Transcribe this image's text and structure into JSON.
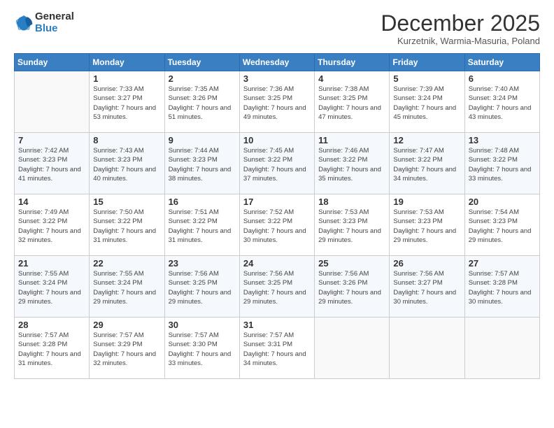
{
  "logo": {
    "general": "General",
    "blue": "Blue"
  },
  "header": {
    "month": "December 2025",
    "location": "Kurzetnik, Warmia-Masuria, Poland"
  },
  "weekdays": [
    "Sunday",
    "Monday",
    "Tuesday",
    "Wednesday",
    "Thursday",
    "Friday",
    "Saturday"
  ],
  "weeks": [
    [
      {
        "day": "",
        "sunrise": "",
        "sunset": "",
        "daylight": ""
      },
      {
        "day": "1",
        "sunrise": "Sunrise: 7:33 AM",
        "sunset": "Sunset: 3:27 PM",
        "daylight": "Daylight: 7 hours and 53 minutes."
      },
      {
        "day": "2",
        "sunrise": "Sunrise: 7:35 AM",
        "sunset": "Sunset: 3:26 PM",
        "daylight": "Daylight: 7 hours and 51 minutes."
      },
      {
        "day": "3",
        "sunrise": "Sunrise: 7:36 AM",
        "sunset": "Sunset: 3:25 PM",
        "daylight": "Daylight: 7 hours and 49 minutes."
      },
      {
        "day": "4",
        "sunrise": "Sunrise: 7:38 AM",
        "sunset": "Sunset: 3:25 PM",
        "daylight": "Daylight: 7 hours and 47 minutes."
      },
      {
        "day": "5",
        "sunrise": "Sunrise: 7:39 AM",
        "sunset": "Sunset: 3:24 PM",
        "daylight": "Daylight: 7 hours and 45 minutes."
      },
      {
        "day": "6",
        "sunrise": "Sunrise: 7:40 AM",
        "sunset": "Sunset: 3:24 PM",
        "daylight": "Daylight: 7 hours and 43 minutes."
      }
    ],
    [
      {
        "day": "7",
        "sunrise": "Sunrise: 7:42 AM",
        "sunset": "Sunset: 3:23 PM",
        "daylight": "Daylight: 7 hours and 41 minutes."
      },
      {
        "day": "8",
        "sunrise": "Sunrise: 7:43 AM",
        "sunset": "Sunset: 3:23 PM",
        "daylight": "Daylight: 7 hours and 40 minutes."
      },
      {
        "day": "9",
        "sunrise": "Sunrise: 7:44 AM",
        "sunset": "Sunset: 3:23 PM",
        "daylight": "Daylight: 7 hours and 38 minutes."
      },
      {
        "day": "10",
        "sunrise": "Sunrise: 7:45 AM",
        "sunset": "Sunset: 3:22 PM",
        "daylight": "Daylight: 7 hours and 37 minutes."
      },
      {
        "day": "11",
        "sunrise": "Sunrise: 7:46 AM",
        "sunset": "Sunset: 3:22 PM",
        "daylight": "Daylight: 7 hours and 35 minutes."
      },
      {
        "day": "12",
        "sunrise": "Sunrise: 7:47 AM",
        "sunset": "Sunset: 3:22 PM",
        "daylight": "Daylight: 7 hours and 34 minutes."
      },
      {
        "day": "13",
        "sunrise": "Sunrise: 7:48 AM",
        "sunset": "Sunset: 3:22 PM",
        "daylight": "Daylight: 7 hours and 33 minutes."
      }
    ],
    [
      {
        "day": "14",
        "sunrise": "Sunrise: 7:49 AM",
        "sunset": "Sunset: 3:22 PM",
        "daylight": "Daylight: 7 hours and 32 minutes."
      },
      {
        "day": "15",
        "sunrise": "Sunrise: 7:50 AM",
        "sunset": "Sunset: 3:22 PM",
        "daylight": "Daylight: 7 hours and 31 minutes."
      },
      {
        "day": "16",
        "sunrise": "Sunrise: 7:51 AM",
        "sunset": "Sunset: 3:22 PM",
        "daylight": "Daylight: 7 hours and 31 minutes."
      },
      {
        "day": "17",
        "sunrise": "Sunrise: 7:52 AM",
        "sunset": "Sunset: 3:22 PM",
        "daylight": "Daylight: 7 hours and 30 minutes."
      },
      {
        "day": "18",
        "sunrise": "Sunrise: 7:53 AM",
        "sunset": "Sunset: 3:23 PM",
        "daylight": "Daylight: 7 hours and 29 minutes."
      },
      {
        "day": "19",
        "sunrise": "Sunrise: 7:53 AM",
        "sunset": "Sunset: 3:23 PM",
        "daylight": "Daylight: 7 hours and 29 minutes."
      },
      {
        "day": "20",
        "sunrise": "Sunrise: 7:54 AM",
        "sunset": "Sunset: 3:23 PM",
        "daylight": "Daylight: 7 hours and 29 minutes."
      }
    ],
    [
      {
        "day": "21",
        "sunrise": "Sunrise: 7:55 AM",
        "sunset": "Sunset: 3:24 PM",
        "daylight": "Daylight: 7 hours and 29 minutes."
      },
      {
        "day": "22",
        "sunrise": "Sunrise: 7:55 AM",
        "sunset": "Sunset: 3:24 PM",
        "daylight": "Daylight: 7 hours and 29 minutes."
      },
      {
        "day": "23",
        "sunrise": "Sunrise: 7:56 AM",
        "sunset": "Sunset: 3:25 PM",
        "daylight": "Daylight: 7 hours and 29 minutes."
      },
      {
        "day": "24",
        "sunrise": "Sunrise: 7:56 AM",
        "sunset": "Sunset: 3:25 PM",
        "daylight": "Daylight: 7 hours and 29 minutes."
      },
      {
        "day": "25",
        "sunrise": "Sunrise: 7:56 AM",
        "sunset": "Sunset: 3:26 PM",
        "daylight": "Daylight: 7 hours and 29 minutes."
      },
      {
        "day": "26",
        "sunrise": "Sunrise: 7:56 AM",
        "sunset": "Sunset: 3:27 PM",
        "daylight": "Daylight: 7 hours and 30 minutes."
      },
      {
        "day": "27",
        "sunrise": "Sunrise: 7:57 AM",
        "sunset": "Sunset: 3:28 PM",
        "daylight": "Daylight: 7 hours and 30 minutes."
      }
    ],
    [
      {
        "day": "28",
        "sunrise": "Sunrise: 7:57 AM",
        "sunset": "Sunset: 3:28 PM",
        "daylight": "Daylight: 7 hours and 31 minutes."
      },
      {
        "day": "29",
        "sunrise": "Sunrise: 7:57 AM",
        "sunset": "Sunset: 3:29 PM",
        "daylight": "Daylight: 7 hours and 32 minutes."
      },
      {
        "day": "30",
        "sunrise": "Sunrise: 7:57 AM",
        "sunset": "Sunset: 3:30 PM",
        "daylight": "Daylight: 7 hours and 33 minutes."
      },
      {
        "day": "31",
        "sunrise": "Sunrise: 7:57 AM",
        "sunset": "Sunset: 3:31 PM",
        "daylight": "Daylight: 7 hours and 34 minutes."
      },
      {
        "day": "",
        "sunrise": "",
        "sunset": "",
        "daylight": ""
      },
      {
        "day": "",
        "sunrise": "",
        "sunset": "",
        "daylight": ""
      },
      {
        "day": "",
        "sunrise": "",
        "sunset": "",
        "daylight": ""
      }
    ]
  ]
}
